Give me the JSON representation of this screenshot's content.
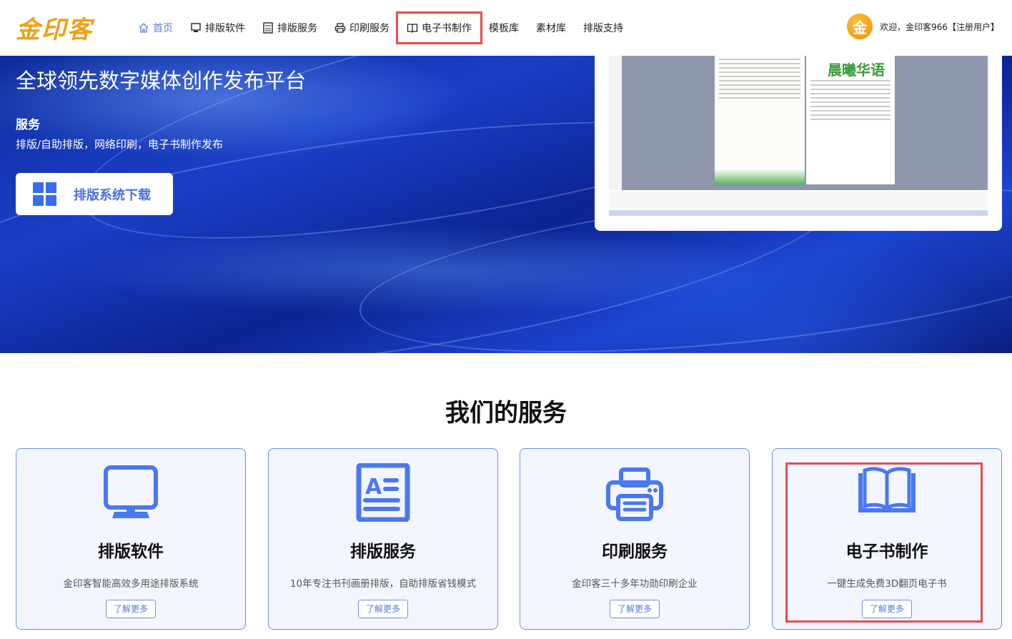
{
  "header": {
    "logo": "金印客",
    "nav": [
      {
        "label": "首页",
        "icon": "home-icon"
      },
      {
        "label": "排版软件",
        "icon": "monitor-icon"
      },
      {
        "label": "排版服务",
        "icon": "document-icon"
      },
      {
        "label": "印刷服务",
        "icon": "printer-icon"
      },
      {
        "label": "电子书制作",
        "icon": "book-icon"
      },
      {
        "label": "模板库"
      },
      {
        "label": "素材库"
      },
      {
        "label": "排版支持"
      }
    ],
    "avatar_glyph": "金",
    "welcome": "欢迎，金印客966【注册用户】"
  },
  "hero": {
    "title": "全球领先数字媒体创作发布平台",
    "subheading": "服务",
    "subtitle": "排版/自助排版，网络印刷，电子书制作发布",
    "download_button": "排版系统下载",
    "preview_newspaper_title": "晨曦华语"
  },
  "services": {
    "title": "我们的服务",
    "cards": [
      {
        "title": "排版软件",
        "desc": "金印客智能高效多用途排版系统",
        "more": "了解更多"
      },
      {
        "title": "排版服务",
        "desc": "10年专注书刊画册排版，自助排版省钱模式",
        "more": "了解更多"
      },
      {
        "title": "印刷服务",
        "desc": "金印客三十多年功勋印刷企业",
        "more": "了解更多"
      },
      {
        "title": "电子书制作",
        "desc": "一键生成免费3D翻页电子书",
        "more": "了解更多"
      }
    ]
  },
  "colors": {
    "accent": "#5a7be0",
    "icon": "#4a78f0",
    "highlight": "#e84c4c",
    "logo": "#f0a010"
  }
}
